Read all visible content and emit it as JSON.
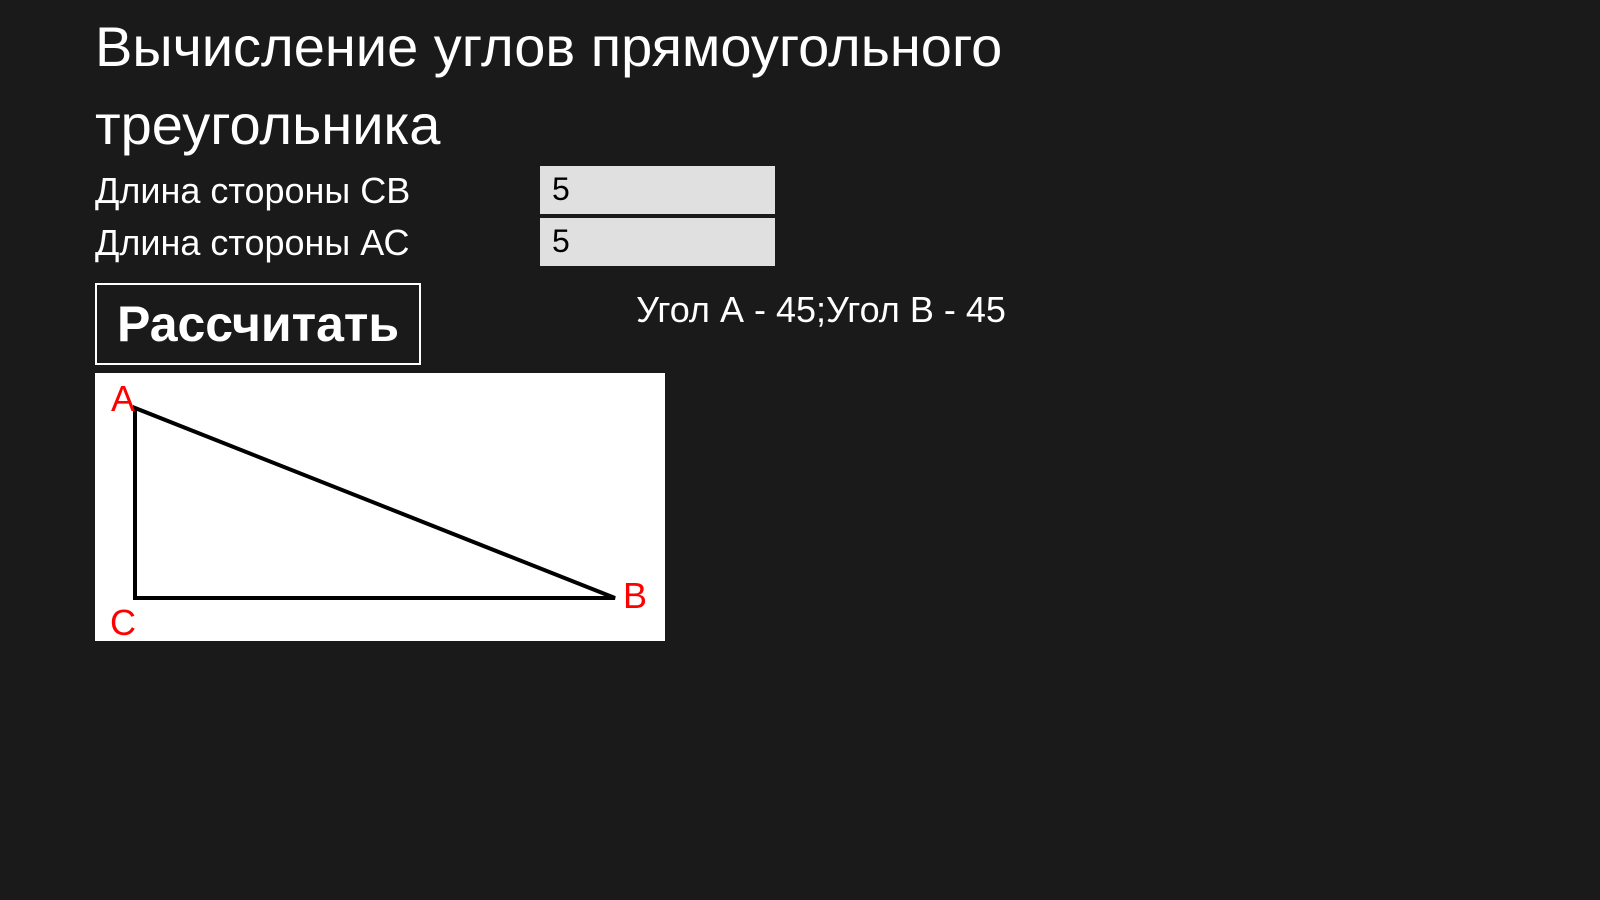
{
  "title": "Вычисление углов прямоугольного треугольника",
  "form": {
    "labelCB": "Длина стороны СВ",
    "valueCB": "5",
    "labelAC": "Длина стороны АС",
    "valueAC": "5"
  },
  "button": {
    "calculate": "Рассчитать"
  },
  "result": "Угол А - 45;Угол В - 45",
  "diagram": {
    "labelA": "A",
    "labelB": "B",
    "labelC": "C"
  }
}
